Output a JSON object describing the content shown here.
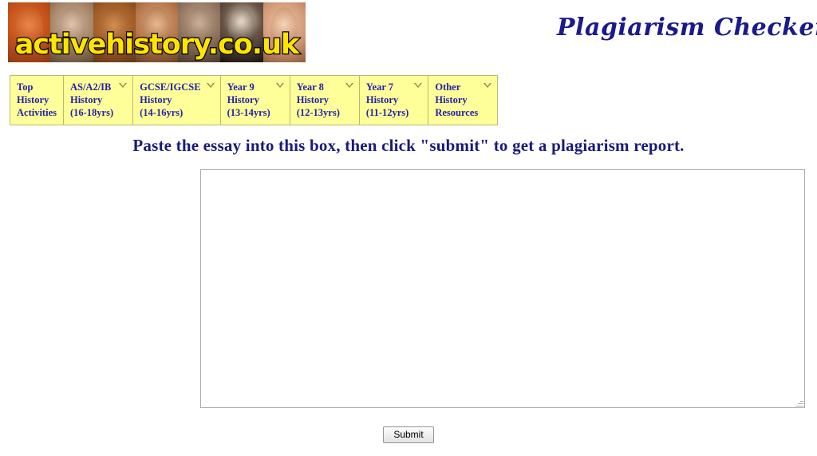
{
  "header": {
    "logo": {
      "wordmark": "activehistory.co.uk",
      "alt": "activehistory.co.uk banner with historical figure portraits"
    },
    "site_title": "Plagiarism Checker"
  },
  "nav": {
    "items": [
      {
        "lines": [
          "Top",
          "History",
          "Activities"
        ],
        "has_caret": false
      },
      {
        "lines": [
          "AS/A2/IB",
          "History",
          "(16-18yrs)"
        ],
        "has_caret": true
      },
      {
        "lines": [
          "GCSE/IGCSE",
          "History",
          "(14-16yrs)"
        ],
        "has_caret": true
      },
      {
        "lines": [
          "Year 9",
          "History",
          "(13-14yrs)"
        ],
        "has_caret": true
      },
      {
        "lines": [
          "Year 8",
          "History",
          "(12-13yrs)"
        ],
        "has_caret": true
      },
      {
        "lines": [
          "Year 7",
          "History",
          "(11-12yrs)"
        ],
        "has_caret": true
      },
      {
        "lines": [
          "Other",
          "History",
          "Resources"
        ],
        "has_caret": true
      }
    ]
  },
  "main": {
    "instruction": "Paste the essay into this box, then click \"submit\" to get a plagiarism report.",
    "essay_box": {
      "value": "",
      "placeholder": ""
    },
    "submit_label": "Submit"
  },
  "colors": {
    "nav_background": "#ffff99",
    "nav_text": "#2222a8",
    "nav_border": "#b9b97a",
    "title_navy": "#1a1a8c",
    "instruction_navy": "#1a1a7a",
    "logo_yellow": "#ffe400",
    "page_background": "#ffffff",
    "box_border": "#a9a9a9"
  }
}
